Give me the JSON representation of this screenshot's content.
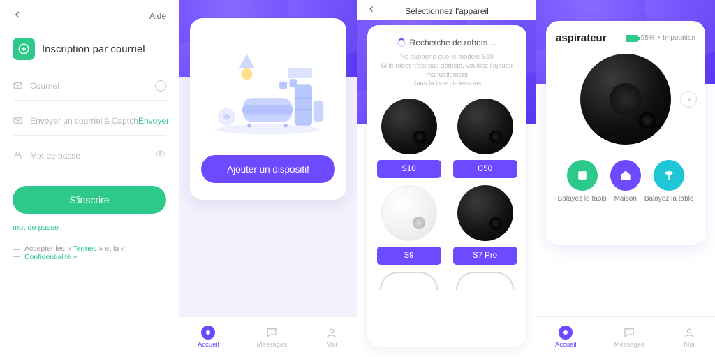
{
  "screen1": {
    "help": "Aide",
    "title": "Inscription par courriel",
    "fields": {
      "email_ph": "Courriel",
      "captcha_ph": "Envoyer un courriel à Captcha",
      "captcha_send": "Envoyer",
      "password_ph": "Mot de passe"
    },
    "submit": "S'inscrire",
    "forgot": "mot de passe",
    "accept_pre": "Accepter les «",
    "accept_terms": "Termes",
    "accept_mid": "» et la «",
    "accept_priv": "Confidentialité",
    "accept_post": "»"
  },
  "screen2": {
    "add_btn": "Ajouter un dispositif"
  },
  "screen3": {
    "header": "Sélectionnez l'appareil",
    "searching": "Recherche de robots ...",
    "note_l1": "Ne supporte que le modèle S10",
    "note_l2": "Si le robot n'est pas détecté, veuillez l'ajouter manuellement",
    "note_l3": "dans la liste ci-dessous",
    "models": {
      "m0": "S10",
      "m1": "C50",
      "m2": "S9",
      "m3": "S7 Pro"
    }
  },
  "screen4": {
    "device_name": "aspirateur",
    "battery_pct": "95%",
    "status": "Imputation",
    "actions": {
      "a0": "Balayez le tapis",
      "a1": "Maison",
      "a2": "Balayez la table"
    }
  },
  "nav": {
    "n0": "Accueil",
    "n1": "Messages",
    "n2": "Moi"
  }
}
